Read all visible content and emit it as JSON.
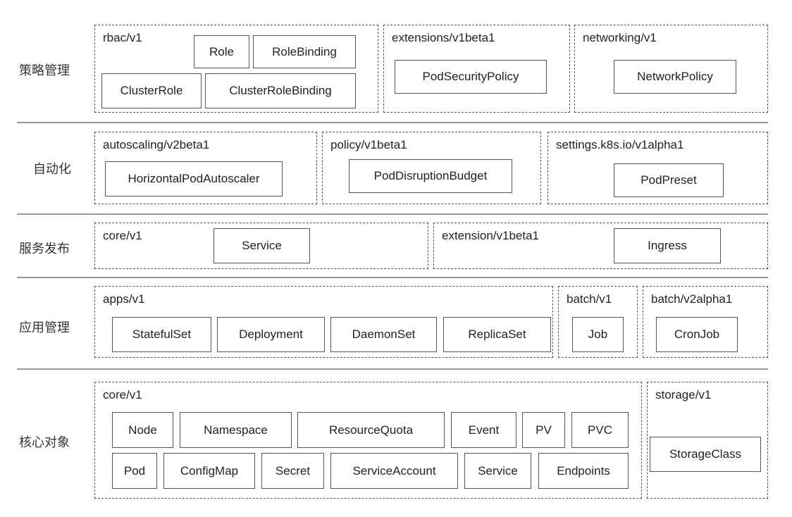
{
  "layers": [
    {
      "label": "策略管理",
      "groups": [
        {
          "api": "rbac/v1",
          "resources": [
            "Role",
            "RoleBinding",
            "ClusterRole",
            "ClusterRoleBinding"
          ]
        },
        {
          "api": "extensions/v1beta1",
          "resources": [
            "PodSecurityPolicy"
          ]
        },
        {
          "api": "networking/v1",
          "resources": [
            "NetworkPolicy"
          ]
        }
      ]
    },
    {
      "label": "自动化",
      "groups": [
        {
          "api": "autoscaling/v2beta1",
          "resources": [
            "HorizontalPodAutoscaler"
          ]
        },
        {
          "api": "policy/v1beta1",
          "resources": [
            "PodDisruptionBudget"
          ]
        },
        {
          "api": "settings.k8s.io/v1alpha1",
          "resources": [
            "PodPreset"
          ]
        }
      ]
    },
    {
      "label": "服务发布",
      "groups": [
        {
          "api": "core/v1",
          "resources": [
            "Service"
          ]
        },
        {
          "api": "extension/v1beta1",
          "resources": [
            "Ingress"
          ]
        }
      ]
    },
    {
      "label": "应用管理",
      "groups": [
        {
          "api": "apps/v1",
          "resources": [
            "StatefulSet",
            "Deployment",
            "DaemonSet",
            "ReplicaSet"
          ]
        },
        {
          "api": "batch/v1",
          "resources": [
            "Job"
          ]
        },
        {
          "api": "batch/v2alpha1",
          "resources": [
            "CronJob"
          ]
        }
      ]
    },
    {
      "label": "核心对象",
      "groups": [
        {
          "api": "core/v1",
          "resources": [
            "Node",
            "Namespace",
            "ResourceQuota",
            "Event",
            "PV",
            "PVC",
            "Pod",
            "ConfigMap",
            "Secret",
            "ServiceAccount",
            "Service",
            "Endpoints"
          ]
        },
        {
          "api": "storage/v1",
          "resources": [
            "StorageClass"
          ]
        }
      ]
    }
  ]
}
